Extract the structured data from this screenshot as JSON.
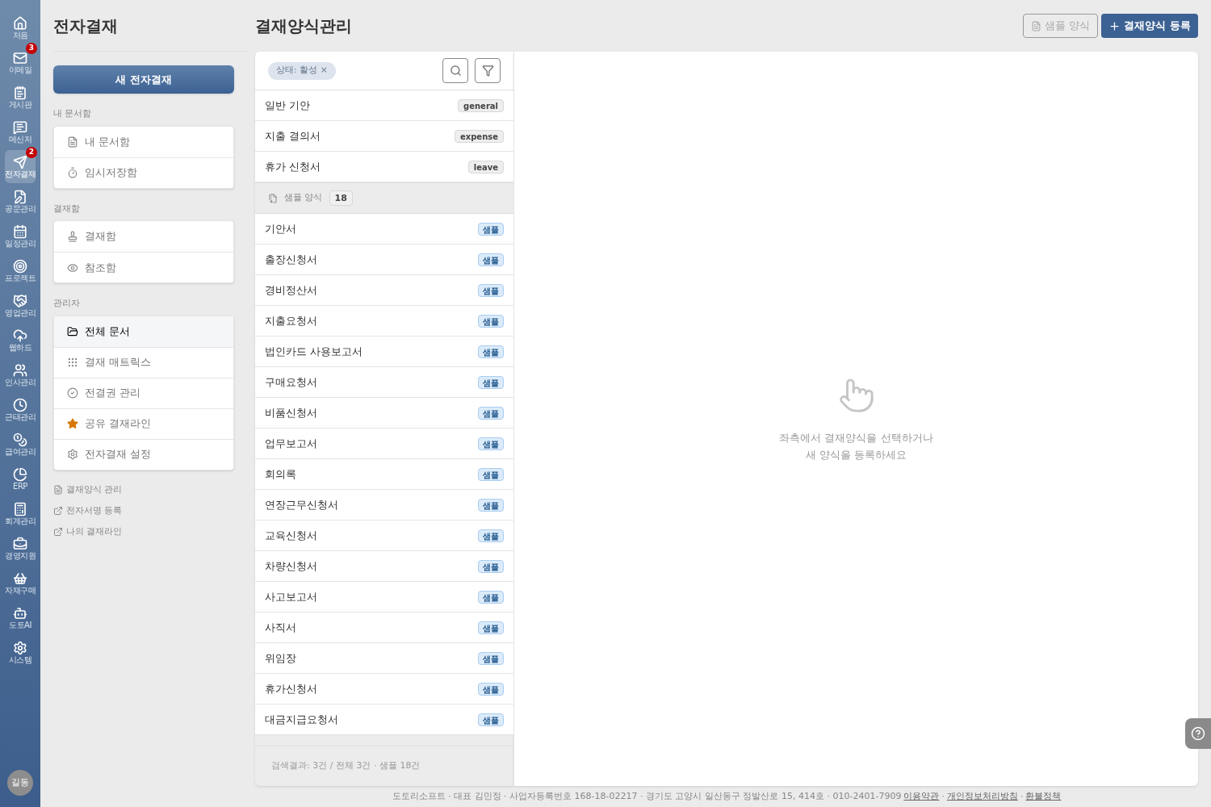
{
  "rail": {
    "items": [
      {
        "label": "처음",
        "selected": false
      },
      {
        "label": "이메일",
        "selected": false,
        "badge": "3"
      },
      {
        "label": "게시판",
        "selected": false
      },
      {
        "label": "메신저",
        "selected": false
      },
      {
        "label": "전자결재",
        "selected": true,
        "badge": "2"
      },
      {
        "label": "공문관리",
        "selected": false
      },
      {
        "label": "일정관리",
        "selected": false
      },
      {
        "label": "프로젝트",
        "selected": false
      },
      {
        "label": "영업관리",
        "selected": false
      },
      {
        "label": "웹하드",
        "selected": false
      },
      {
        "label": "인사관리",
        "selected": false
      },
      {
        "label": "근태관리",
        "selected": false
      },
      {
        "label": "급여관리",
        "selected": false
      },
      {
        "label": "ERP",
        "selected": false
      },
      {
        "label": "회계관리",
        "selected": false
      },
      {
        "label": "경영지원",
        "selected": false
      },
      {
        "label": "자재구매",
        "selected": false
      },
      {
        "label": "도토AI",
        "selected": false
      },
      {
        "label": "시스템",
        "selected": false
      }
    ],
    "avatar": "길동"
  },
  "sidebar": {
    "title": "전자결재",
    "new_button": "새 전자결재",
    "sections": [
      {
        "heading": "내 문서함",
        "items": [
          {
            "label": "내 문서함",
            "selected": false
          },
          {
            "label": "임시저장함",
            "selected": false
          }
        ]
      },
      {
        "heading": "결재함",
        "items": [
          {
            "label": "결재함",
            "selected": false
          },
          {
            "label": "참조함",
            "selected": false
          }
        ]
      },
      {
        "heading": "관리자",
        "items": [
          {
            "label": "전체 문서",
            "selected": true
          },
          {
            "label": "결재 매트릭스",
            "selected": false
          },
          {
            "label": "전결권 관리",
            "selected": false
          },
          {
            "label": "공유 결재라인",
            "selected": false
          },
          {
            "label": "전자결재 설정",
            "selected": false
          }
        ]
      }
    ],
    "links": [
      {
        "kind": "document",
        "label": "결재양식 관리"
      },
      {
        "kind": "external",
        "label": "전자서명 등록"
      },
      {
        "kind": "external",
        "label": "나의 결재라인"
      }
    ]
  },
  "page": {
    "title": "결재양식관리",
    "buttons": [
      {
        "kind": "outline",
        "label": "샘플 양식"
      },
      {
        "kind": "primary",
        "label": "결재양식 등록"
      }
    ]
  },
  "form_list": {
    "filter_chip": "상태: 활성 ×",
    "forms": [
      {
        "name": "일반 기안",
        "tag": "general"
      },
      {
        "name": "지출 결의서",
        "tag": "expense"
      },
      {
        "name": "휴가 신청서",
        "tag": "leave"
      }
    ],
    "sample_group": {
      "label": "샘플 양식",
      "count": "18",
      "items": [
        {
          "name": "기안서",
          "badge": "샘플"
        },
        {
          "name": "출장신청서",
          "badge": "샘플"
        },
        {
          "name": "경비정산서",
          "badge": "샘플"
        },
        {
          "name": "지출요청서",
          "badge": "샘플"
        },
        {
          "name": "법인카드 사용보고서",
          "badge": "샘플"
        },
        {
          "name": "구매요청서",
          "badge": "샘플"
        },
        {
          "name": "비품신청서",
          "badge": "샘플"
        },
        {
          "name": "업무보고서",
          "badge": "샘플"
        },
        {
          "name": "회의록",
          "badge": "샘플"
        },
        {
          "name": "연장근무신청서",
          "badge": "샘플"
        },
        {
          "name": "교육신청서",
          "badge": "샘플"
        },
        {
          "name": "차량신청서",
          "badge": "샘플"
        },
        {
          "name": "사고보고서",
          "badge": "샘플"
        },
        {
          "name": "사직서",
          "badge": "샘플"
        },
        {
          "name": "위임장",
          "badge": "샘플"
        },
        {
          "name": "휴가신청서",
          "badge": "샘플"
        },
        {
          "name": "대금지급요청서",
          "badge": "샘플"
        }
      ]
    },
    "summary": "검색결과: 3건 / 전체 3건 · 샘플 18건"
  },
  "detail": {
    "empty_lines": [
      "좌측에서 결재양식을 선택하거나",
      "새 양식을 등록하세요"
    ]
  },
  "footer": {
    "text": "도토리소프트 · 대표 김민정 · 사업자등록번호 168-18-02217 · 경기도 고양시 일산동구 정발산로 15, 414호 · 010-2401-7909",
    "links": [
      "이용약관",
      "개인정보처리방침",
      "환불정책"
    ],
    "separator": "·"
  }
}
